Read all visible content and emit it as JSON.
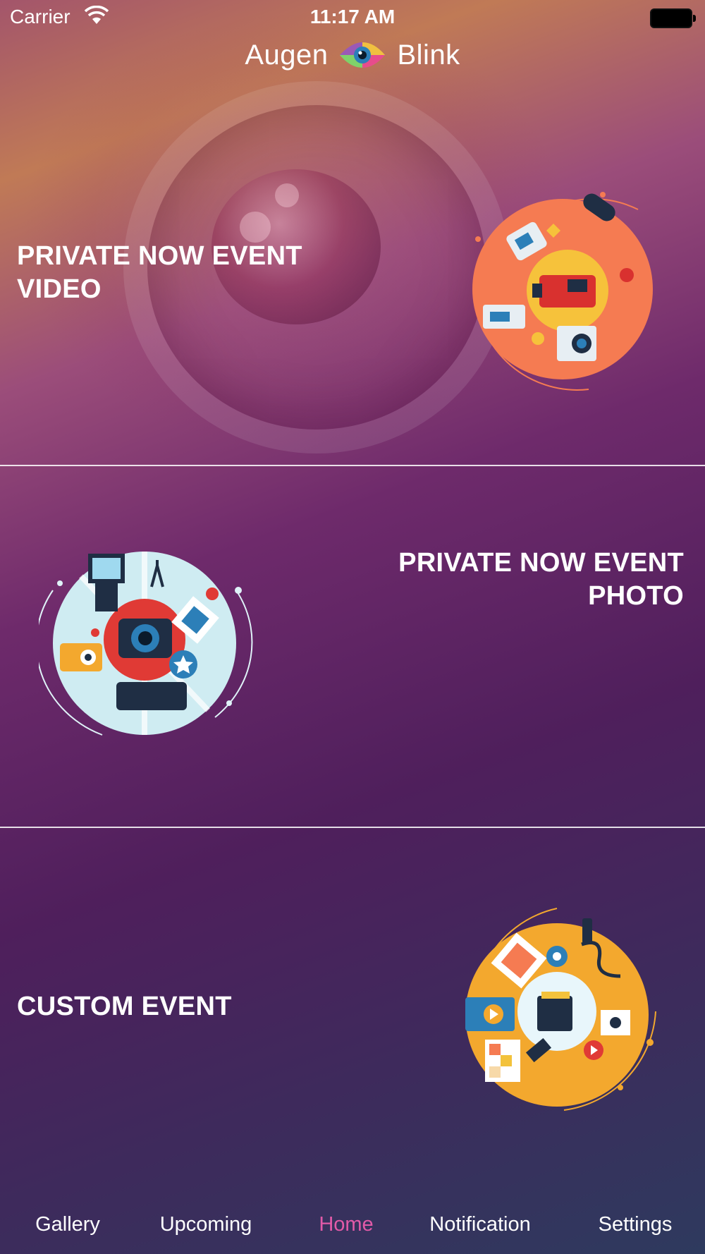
{
  "status_bar": {
    "carrier": "Carrier",
    "time": "11:17 AM",
    "wifi_icon": "wifi-icon",
    "battery_icon": "battery-icon"
  },
  "app_bar": {
    "title_left": "Augen",
    "title_right": "Blink",
    "logo_icon": "eye-logo-icon"
  },
  "events": [
    {
      "label_line1": "PRIVATE NOW EVENT",
      "label_line2": "VIDEO",
      "illustration": "video-equipment-illustration"
    },
    {
      "label_line1": "PRIVATE NOW EVENT",
      "label_line2": "PHOTO",
      "illustration": "photo-camera-illustration"
    },
    {
      "label_line1": "CUSTOM EVENT",
      "label_line2": "",
      "illustration": "media-sd-card-illustration"
    }
  ],
  "tabs": [
    {
      "label": "Gallery",
      "active": false
    },
    {
      "label": "Upcoming",
      "active": false
    },
    {
      "label": "Home",
      "active": true
    },
    {
      "label": "Notification",
      "active": false
    },
    {
      "label": "Settings",
      "active": false
    }
  ],
  "colors": {
    "active_tab": "#e25aa8",
    "video_circle": "#f57b52",
    "photo_circle": "#cfecf2",
    "custom_circle": "#f3a82e"
  }
}
